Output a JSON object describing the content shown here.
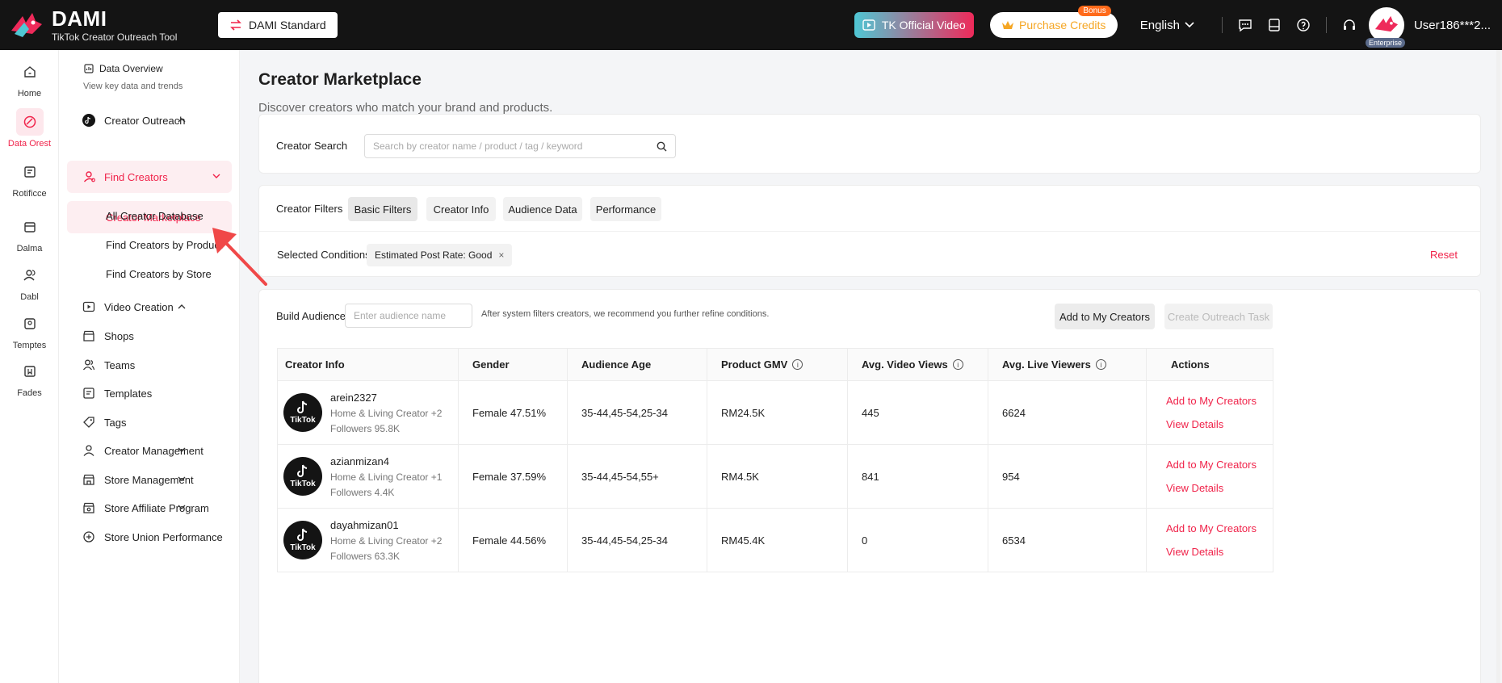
{
  "brand": {
    "name": "DAMI",
    "subtitle": "TikTok Creator Outreach Tool"
  },
  "topbar": {
    "plan": "DAMI Standard",
    "tk_video": "TK Official Video",
    "credits": "Purchase Credits",
    "bonus": "Bonus",
    "language": "English",
    "enterprise": "Enterprise",
    "username": "User186***2..."
  },
  "rail": [
    {
      "label": "Home",
      "icon": "home-icon"
    },
    {
      "label": "Data Orest",
      "icon": "data-icon"
    },
    {
      "label": "Rotificce",
      "icon": "report-icon"
    },
    {
      "label": "Dalma",
      "icon": "store-icon"
    },
    {
      "label": "Dabl",
      "icon": "users-icon"
    },
    {
      "label": "Temptes",
      "icon": "template-icon"
    },
    {
      "label": "Fades",
      "icon": "bookmark-icon"
    }
  ],
  "menu": {
    "data_overview": "Data Overview",
    "data_overview_sub": "View key data and trends",
    "creator_outreach": "Creator Outreach",
    "find_creators": "Find Creators",
    "creator_marketplace": "Creator Marketplace",
    "all_creator_database": "All Creator Database",
    "find_by_product": "Find Creators by Product",
    "find_by_store": "Find Creators by Store",
    "video_creation": "Video Creation",
    "shops": "Shops",
    "teams": "Teams",
    "templates": "Templates",
    "tags": "Tags",
    "creator_management": "Creator Management",
    "store_management": "Store Management",
    "store_affiliate": "Store Affiliate Program",
    "store_union": "Store Union Performance"
  },
  "page": {
    "title": "Creator Marketplace",
    "subtitle": "Discover creators who match your brand and products."
  },
  "search": {
    "label": "Creator Search",
    "placeholder": "Search by creator name / product / tag / keyword"
  },
  "filters": {
    "label": "Creator Filters",
    "tabs": [
      "Basic Filters",
      "Creator Info",
      "Audience Data",
      "Performance"
    ],
    "selected_label": "Selected Conditions",
    "selected_tag": "Estimated Post Rate: Good",
    "reset": "Reset"
  },
  "audience": {
    "label": "Build Audience",
    "placeholder": "Enter audience name",
    "hint": "After system filters creators, we recommend you further refine conditions.",
    "add_btn": "Add to My Creators",
    "outreach_btn": "Create Outreach Task"
  },
  "table": {
    "headers": [
      "Creator Info",
      "Gender",
      "Audience Age",
      "Product GMV",
      "Avg. Video Views",
      "Avg. Live Viewers",
      "Actions"
    ],
    "logo_text": "TikTok",
    "action_add": "Add to My Creators",
    "action_view": "View Details",
    "rows": [
      {
        "name": "arein2327",
        "category": "Home & Living Creator +2",
        "followers": "Followers 95.8K",
        "gender": "Female 47.51%",
        "age": "35-44,45-54,25-34",
        "gmv": "RM24.5K",
        "views": "445",
        "live": "6624"
      },
      {
        "name": "azianmizan4",
        "category": "Home & Living Creator +1",
        "followers": "Followers 4.4K",
        "gender": "Female 37.59%",
        "age": "35-44,45-54,55+",
        "gmv": "RM4.5K",
        "views": "841",
        "live": "954"
      },
      {
        "name": "dayahmizan01",
        "category": "Home & Living Creator +2",
        "followers": "Followers 63.3K",
        "gender": "Female 44.56%",
        "age": "35-44,45-54,25-34",
        "gmv": "RM45.4K",
        "views": "0",
        "live": "6534"
      }
    ]
  },
  "colors": {
    "accent": "#f0234a",
    "topbar": "#141414",
    "credits": "#f5a623"
  }
}
